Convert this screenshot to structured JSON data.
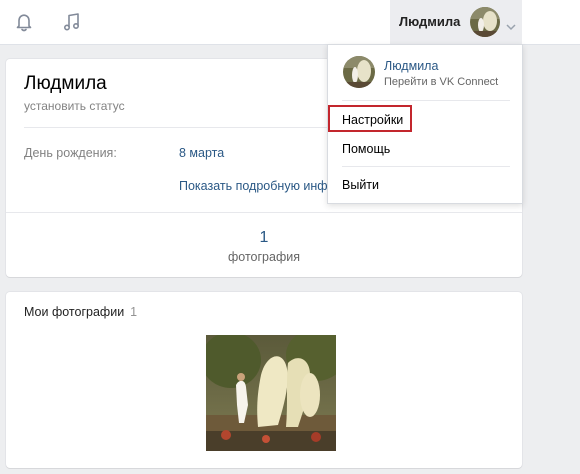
{
  "header": {
    "user_name": "Людмила",
    "icons": [
      "bell-icon",
      "music-note-icon",
      "chevron-down-icon"
    ]
  },
  "profile": {
    "name": "Людмила",
    "status_placeholder": "установить статус",
    "birthday_label": "День рождения:",
    "birthday_value": "8 марта",
    "more_info_link": "Показать подробную инф",
    "photos_count": "1",
    "photos_count_label": "фотография"
  },
  "photos_section": {
    "title": "Мои фотографии",
    "count": "1"
  },
  "dropdown": {
    "name": "Людмила",
    "subtitle": "Перейти в VK Connect",
    "items": [
      "Настройки",
      "Помощь",
      "Выйти"
    ],
    "highlight_color": "#c3262d"
  },
  "colors": {
    "link": "#2a5885",
    "background": "#edeef0"
  }
}
